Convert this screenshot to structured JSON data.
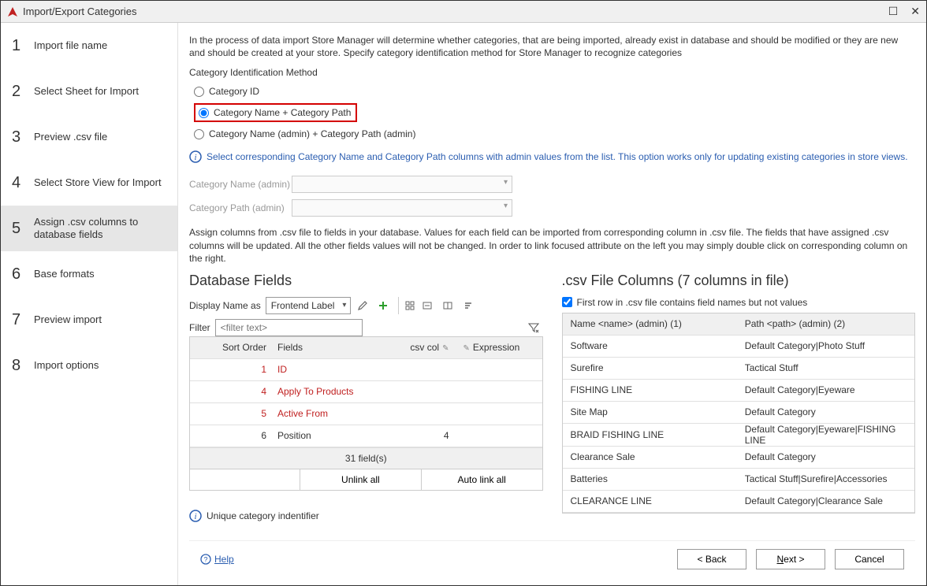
{
  "window_title": "Import/Export Categories",
  "steps": [
    {
      "num": "1",
      "label": "Import file name"
    },
    {
      "num": "2",
      "label": "Select Sheet for Import"
    },
    {
      "num": "3",
      "label": "Preview .csv file"
    },
    {
      "num": "4",
      "label": "Select Store View for Import"
    },
    {
      "num": "5",
      "label": "Assign .csv columns to database fields"
    },
    {
      "num": "6",
      "label": "Base formats"
    },
    {
      "num": "7",
      "label": "Preview import"
    },
    {
      "num": "8",
      "label": "Import options"
    }
  ],
  "active_step_index": 4,
  "intro_text": "In the process of data import Store Manager will determine whether categories, that are being imported, already exist in database and should be modified or they are new and should be created at your store. Specify category identification method for Store Manager to recognize categories",
  "identification_label": "Category Identification Method",
  "radios": [
    "Category ID",
    "Category Name + Category Path",
    "Category Name (admin) + Category Path (admin)"
  ],
  "selected_radio_index": 1,
  "info_text": "Select corresponding Category Name and Category Path columns with admin values from the list.  This option works only for updating existing categories in store views.",
  "admin_labels": {
    "name": "Category Name (admin)",
    "path": "Category Path (admin)"
  },
  "assign_text": "Assign columns from .csv file to fields in your database. Values for each field can be imported from corresponding column in .csv file. The fields that have assigned .csv columns will be updated. All the other fields values will not be changed. In order to link focused attribute on the left you may simply double click on corresponding column on the right.",
  "db_fields": {
    "title": "Database Fields",
    "display_label": "Display Name as",
    "display_value": "Frontend Label",
    "filter_label": "Filter",
    "filter_placeholder": "<filter text>",
    "columns": {
      "sort": "Sort Order",
      "fields": "Fields",
      "csv": "csv col",
      "expr": "Expression"
    },
    "rows": [
      {
        "sort": "1",
        "field": "ID",
        "csv": "",
        "expr": "",
        "red": true
      },
      {
        "sort": "4",
        "field": "Apply To Products",
        "csv": "",
        "expr": "",
        "red": true
      },
      {
        "sort": "5",
        "field": "Active From",
        "csv": "",
        "expr": "",
        "red": true
      },
      {
        "sort": "6",
        "field": "Position",
        "csv": "4",
        "expr": "",
        "red": false
      }
    ],
    "footer": "31 field(s)",
    "unlink": "Unlink all",
    "autolink": "Auto link all"
  },
  "csv": {
    "title": ".csv File Columns (7 columns in file)",
    "checkbox": "First row in .csv file contains field names but not values",
    "checkbox_checked": true,
    "columns": {
      "a": "Name <name> (admin) (1)",
      "b": "Path <path> (admin) (2)"
    },
    "rows": [
      {
        "a": "Software",
        "b": "Default Category|Photo Stuff"
      },
      {
        "a": "Surefire",
        "b": "Tactical Stuff"
      },
      {
        "a": "FISHING LINE",
        "b": "Default Category|Eyeware"
      },
      {
        "a": "Site Map",
        "b": "Default Category"
      },
      {
        "a": "BRAID FISHING LINE",
        "b": "Default Category|Eyeware|FISHING LINE"
      },
      {
        "a": "Clearance Sale",
        "b": "Default Category"
      },
      {
        "a": "Batteries",
        "b": "Tactical Stuff|Surefire|Accessories"
      },
      {
        "a": "CLEARANCE LINE",
        "b": "Default Category|Clearance Sale"
      }
    ]
  },
  "unique_text": "Unique category indentifier",
  "help": "Help",
  "buttons": {
    "back": "< Back",
    "next": "Next >",
    "cancel": "Cancel"
  }
}
